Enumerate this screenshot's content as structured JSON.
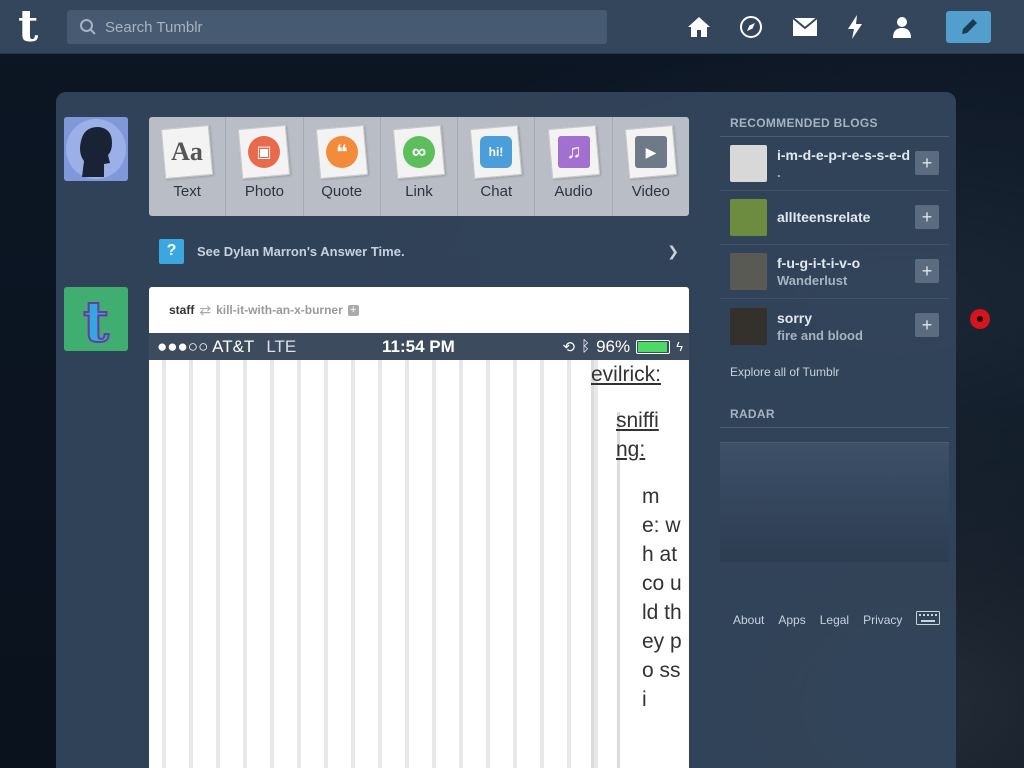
{
  "search": {
    "placeholder": "Search Tumblr"
  },
  "nav": {
    "icons": [
      "home-icon",
      "explore-icon",
      "inbox-icon",
      "activity-icon",
      "account-icon"
    ],
    "compose_icon": "pencil-icon"
  },
  "post_types": [
    {
      "label": "Text",
      "color": "#555555",
      "glyph": "Aa"
    },
    {
      "label": "Photo",
      "color": "#e86a4a",
      "glyph": "▣"
    },
    {
      "label": "Quote",
      "color": "#f28b3a",
      "glyph": "❝"
    },
    {
      "label": "Link",
      "color": "#5cbf5c",
      "glyph": "∞"
    },
    {
      "label": "Chat",
      "color": "#4a9ed9",
      "glyph": "hi!"
    },
    {
      "label": "Audio",
      "color": "#a36fd0",
      "glyph": "♫"
    },
    {
      "label": "Video",
      "color": "#6e7a88",
      "glyph": "▶"
    }
  ],
  "answer_banner": {
    "text": "See Dylan Marron's Answer Time."
  },
  "post": {
    "author": "staff",
    "reblog_source": "kill-it-with-an-x-burner",
    "phone_status": {
      "carrier": "●●●○○ AT&T",
      "network": "LTE",
      "time": "11:54 PM",
      "battery": "96%",
      "battery_level": 0.96
    },
    "thread": [
      {
        "user": "evilrick:"
      },
      {
        "user": "sniffi ng:"
      },
      {
        "body": "m e: wh at co uld th ey po ssi"
      }
    ]
  },
  "sidebar": {
    "recommended_title": "RECOMMENDED BLOGS",
    "blogs": [
      {
        "name": "i-m-d-e-p-r-e-s-s-e-d",
        "sub": ".",
        "color": "#d8d8d8"
      },
      {
        "name": "allIteensrelate",
        "sub": "",
        "color": "#6d8c3f"
      },
      {
        "name": "f-u-g-i-t-i-v-o",
        "sub": "Wanderlust",
        "color": "#5a5a55"
      },
      {
        "name": "sorry",
        "sub": "fire and blood",
        "color": "#34302c"
      }
    ],
    "explore": "Explore all of Tumblr",
    "radar_title": "RADAR"
  },
  "footer": {
    "about": "About",
    "apps": "Apps",
    "legal": "Legal",
    "privacy": "Privacy"
  }
}
